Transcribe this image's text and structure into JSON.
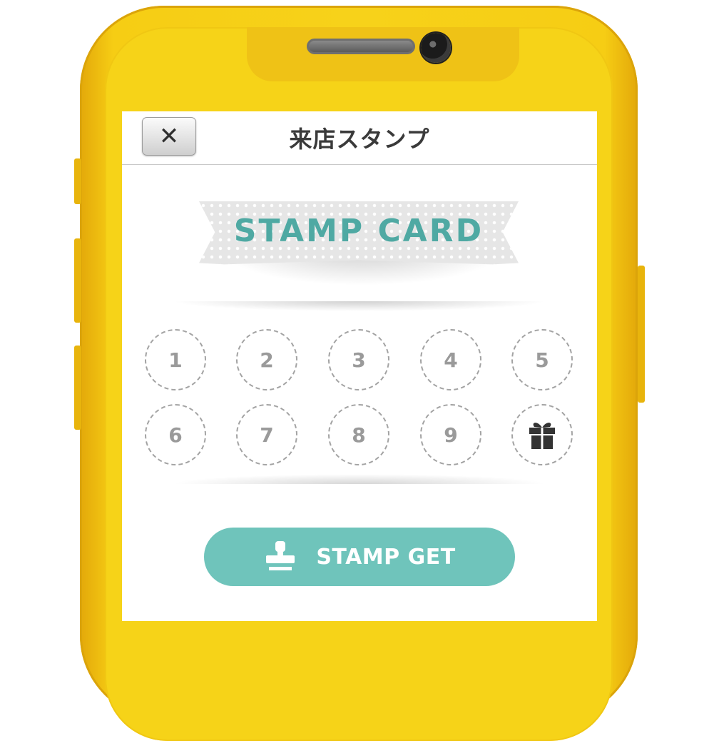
{
  "navbar": {
    "close_label": "✕",
    "title": "来店スタンプ"
  },
  "card": {
    "ribbon_title": "STAMP CARD",
    "slots": [
      "1",
      "2",
      "3",
      "4",
      "5",
      "6",
      "7",
      "8",
      "9"
    ],
    "reward_icon": "gift-icon",
    "stamps_collected": 0
  },
  "action": {
    "button_label": "STAMP GET",
    "button_icon": "stamp-icon"
  },
  "colors": {
    "phone_body": "#f6d318",
    "accent_teal": "#6fc4bb",
    "ribbon_text": "#4fa9a3",
    "slot_number": "#9a9a9a"
  }
}
